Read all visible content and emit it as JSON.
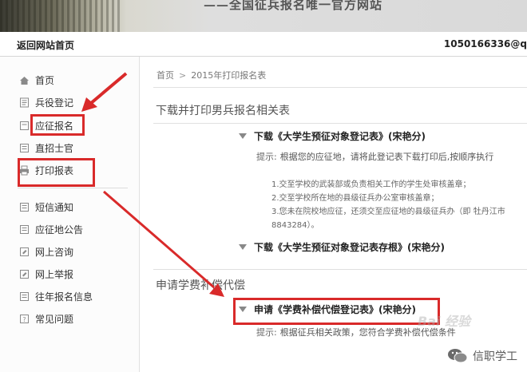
{
  "banner": {
    "slogan": "——全国征兵报名唯一官方网站"
  },
  "topbar": {
    "back_label": "返回网站首页",
    "account": "1050166336@q"
  },
  "sidebar": {
    "items": [
      {
        "label": "首页",
        "icon": "home-icon"
      },
      {
        "label": "兵役登记",
        "icon": "form-icon"
      },
      {
        "label": "应征报名",
        "icon": "enlist-icon"
      },
      {
        "label": "直招士官",
        "icon": "officer-icon"
      },
      {
        "label": "打印报表",
        "icon": "print-icon"
      },
      {
        "label": "短信通知",
        "icon": "sms-icon"
      },
      {
        "label": "应征地公告",
        "icon": "notice-icon"
      },
      {
        "label": "网上咨询",
        "icon": "consult-icon"
      },
      {
        "label": "网上举报",
        "icon": "report-icon"
      },
      {
        "label": "往年报名信息",
        "icon": "history-icon"
      },
      {
        "label": "常见问题",
        "icon": "faq-icon"
      }
    ]
  },
  "breadcrumb": {
    "home": "首页",
    "separator": ">",
    "current": "2015年打印报名表"
  },
  "download_section": {
    "title": "下载并打印男兵报名相关表",
    "item1": "下载《大学生预征对象登记表》(宋艳分)",
    "hint_label": "提示:",
    "hint_text": "根据您的应征地，请将此登记表下载打印后,按顺序执行",
    "steps": [
      "1.交至学校的武装部或负责相关工作的学生处审核盖章；",
      "2.交至学校所在地的县级征兵办公室审核盖章；",
      "3.您未在院校地应征，还须交至应征地的县级征兵办（即 牡丹江市",
      "8843284）。"
    ],
    "item2": "下载《大学生预征对象登记表存根》(宋艳分)"
  },
  "compensation_section": {
    "title": "申请学费补偿代偿",
    "item": "申请《学费补偿代偿登记表》(宋艳分)",
    "hint_label": "提示:",
    "hint_text": "根据征兵相关政策，您符合学费补偿代偿条件"
  },
  "watermark": {
    "text": "信职学工",
    "baidu": "Bai 经验"
  },
  "colors": {
    "annotation_red": "#d92a2a",
    "sidebar_bg": "#fcfcfc"
  }
}
